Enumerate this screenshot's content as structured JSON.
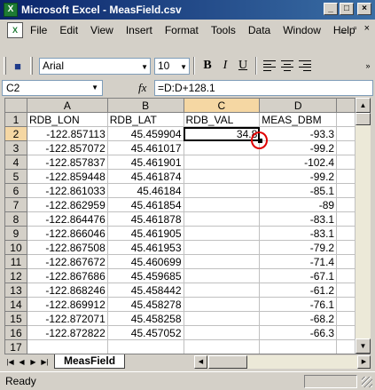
{
  "window": {
    "title": "Microsoft Excel - MeasField.csv",
    "app_icon": "excel-icon"
  },
  "menu": [
    "File",
    "Edit",
    "View",
    "Insert",
    "Format",
    "Tools",
    "Data",
    "Window",
    "Help"
  ],
  "toolbar": {
    "font": "Arial",
    "size": "10",
    "bold": "B",
    "italic": "I",
    "underline": "U"
  },
  "formula_bar": {
    "name_box": "C2",
    "fx": "fx",
    "formula": "=D:D+128.1"
  },
  "columns": [
    "A",
    "B",
    "C",
    "D"
  ],
  "headers": [
    "RDB_LON",
    "RDB_LAT",
    "RDB_VAL",
    "MEAS_DBM"
  ],
  "rows": [
    {
      "n": "2",
      "a": "-122.857113",
      "b": "45.459904",
      "c": "34.8",
      "d": "-93.3"
    },
    {
      "n": "3",
      "a": "-122.857072",
      "b": "45.461017",
      "c": "",
      "d": "-99.2"
    },
    {
      "n": "4",
      "a": "-122.857837",
      "b": "45.461901",
      "c": "",
      "d": "-102.4"
    },
    {
      "n": "5",
      "a": "-122.859448",
      "b": "45.461874",
      "c": "",
      "d": "-99.2"
    },
    {
      "n": "6",
      "a": "-122.861033",
      "b": "45.46184",
      "c": "",
      "d": "-85.1"
    },
    {
      "n": "7",
      "a": "-122.862959",
      "b": "45.461854",
      "c": "",
      "d": "-89"
    },
    {
      "n": "8",
      "a": "-122.864476",
      "b": "45.461878",
      "c": "",
      "d": "-83.1"
    },
    {
      "n": "9",
      "a": "-122.866046",
      "b": "45.461905",
      "c": "",
      "d": "-83.1"
    },
    {
      "n": "10",
      "a": "-122.867508",
      "b": "45.461953",
      "c": "",
      "d": "-79.2"
    },
    {
      "n": "11",
      "a": "-122.867672",
      "b": "45.460699",
      "c": "",
      "d": "-71.4"
    },
    {
      "n": "12",
      "a": "-122.867686",
      "b": "45.459685",
      "c": "",
      "d": "-67.1"
    },
    {
      "n": "13",
      "a": "-122.868246",
      "b": "45.458442",
      "c": "",
      "d": "-61.2"
    },
    {
      "n": "14",
      "a": "-122.869912",
      "b": "45.458278",
      "c": "",
      "d": "-76.1"
    },
    {
      "n": "15",
      "a": "-122.872071",
      "b": "45.458258",
      "c": "",
      "d": "-68.2"
    },
    {
      "n": "16",
      "a": "-122.872822",
      "b": "45.457052",
      "c": "",
      "d": "-66.3"
    },
    {
      "n": "17",
      "a": "",
      "b": "",
      "c": "",
      "d": ""
    }
  ],
  "sheet_tab": "MeasField",
  "status": "Ready"
}
